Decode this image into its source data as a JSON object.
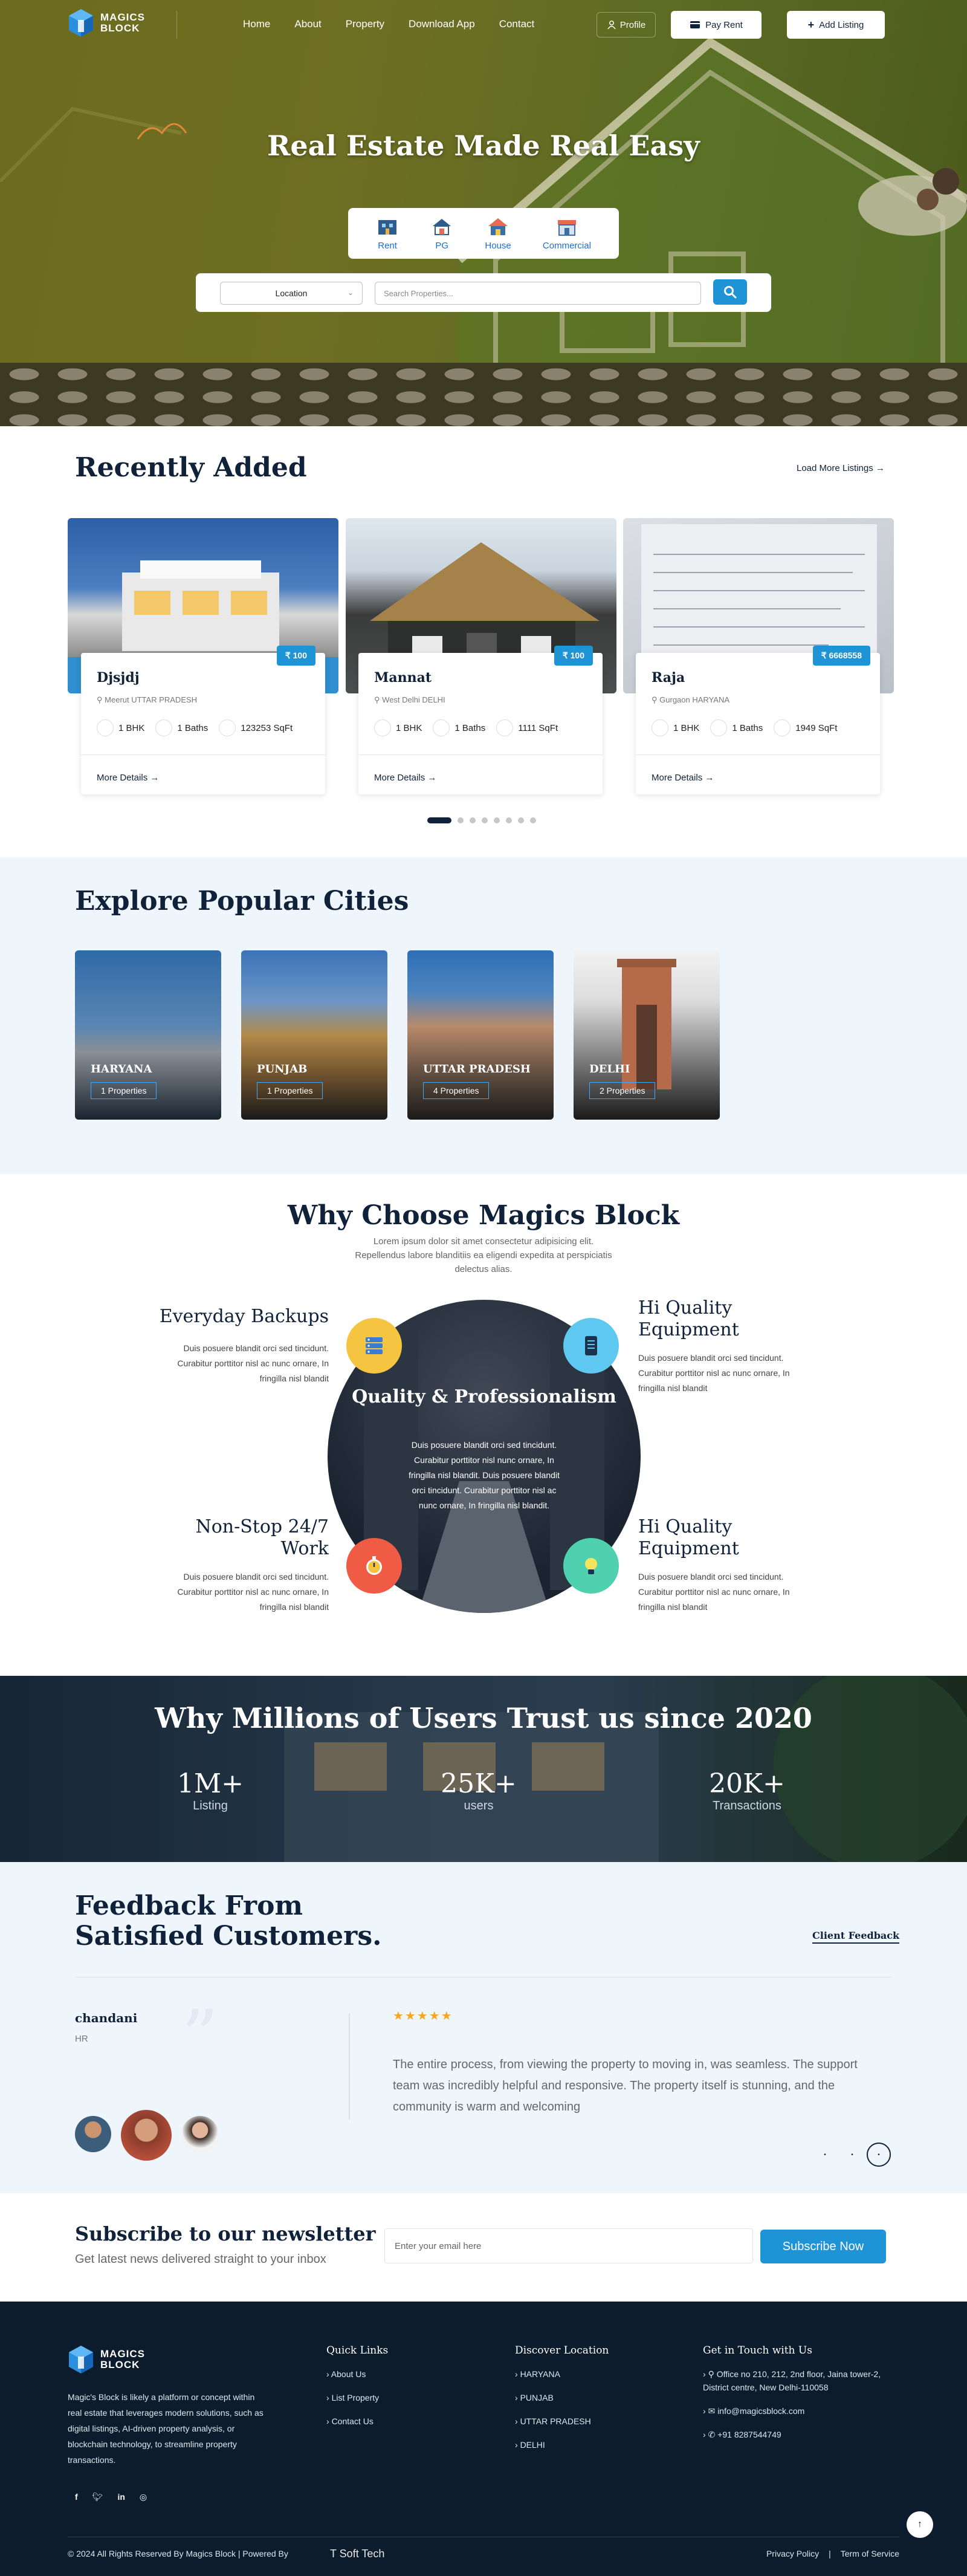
{
  "brand": {
    "line1": "MAGICS",
    "line2": "BLOCK",
    "accent": "#1e93d6",
    "dark": "#10223a"
  },
  "nav": {
    "links": [
      "Home",
      "About",
      "Property",
      "Download App",
      "Contact"
    ],
    "profile": "Profile",
    "pay_rent": "Pay Rent",
    "add_listing": "Add Listing"
  },
  "hero": {
    "title": "Real Estate Made Real Easy",
    "types": [
      "Rent",
      "PG",
      "House",
      "Commercial"
    ],
    "location_select": "Location",
    "search_placeholder": "Search Properties..."
  },
  "recent": {
    "title": "Recently Added",
    "load_more": "Load More Listings",
    "cards": [
      {
        "title": "Djsjdj",
        "price": "₹ 100",
        "location": "Meerut UTTAR PRADESH",
        "bhk": "1 BHK",
        "baths": "1 Baths",
        "area": "123253 SqFt",
        "more": "More Details"
      },
      {
        "title": "Mannat",
        "price": "₹ 100",
        "location": "West Delhi DELHI",
        "bhk": "1 BHK",
        "baths": "1 Baths",
        "area": "1111 SqFt",
        "more": "More Details"
      },
      {
        "title": "Raja",
        "price": "₹ 6668558",
        "location": "Gurgaon HARYANA",
        "bhk": "1 BHK",
        "baths": "1 Baths",
        "area": "1949 SqFt",
        "more": "More Details"
      }
    ]
  },
  "cities": {
    "title": "Explore Popular Cities",
    "items": [
      {
        "name": "HARYANA",
        "count": "1 Properties"
      },
      {
        "name": "PUNJAB",
        "count": "1 Properties"
      },
      {
        "name": "UTTAR PRADESH",
        "count": "4 Properties"
      },
      {
        "name": "DELHI",
        "count": "2 Properties"
      }
    ]
  },
  "why": {
    "title": "Why Choose Magics Block",
    "subtitle": "Lorem ipsum dolor sit amet consectetur adipisicing elit. Repellendus labore blanditiis ea eligendi expedita at perspiciatis delectus alias.",
    "center_title": "Quality & Professionalism",
    "center_desc": "Duis posuere blandit orci sed tincidunt. Curabitur porttitor nisl nunc ornare, In fringilla nisl blandit. Duis posuere blandit orci tincidunt. Curabitur porttitor nisl ac nunc ornare, In fringilla nisl blandit.",
    "features": [
      {
        "title": "Everyday Backups",
        "desc": "Duis posuere blandit orci sed tincidunt. Curabitur porttitor nisl ac nunc ornare, In fringilla nisl blandit"
      },
      {
        "title": "Hi Quality Equipment",
        "desc": "Duis posuere blandit orci sed tincidunt. Curabitur porttitor nisl ac nunc ornare, In fringilla nisl blandit"
      },
      {
        "title": "Non-Stop 24/7 Work",
        "desc": "Duis posuere blandit orci sed tincidunt. Curabitur porttitor nisl ac nunc ornare, In fringilla nisl blandit"
      },
      {
        "title": "Hi Quality Equipment",
        "desc": "Duis posuere blandit orci sed tincidunt. Curabitur porttitor nisl ac nunc ornare, In fringilla nisl blandit"
      }
    ]
  },
  "trust": {
    "title": "Why Millions of Users Trust us since 2020",
    "stats": [
      {
        "value": "1M+",
        "label": "Listing"
      },
      {
        "value": "25K+",
        "label": "users"
      },
      {
        "value": "20K+",
        "label": "Transactions"
      }
    ]
  },
  "feedback": {
    "title_line1": "Feedback From",
    "title_line2": "Satisfied Customers.",
    "link": "Client Feedback",
    "name": "chandani",
    "role": "HR",
    "rating": "★★★★★",
    "text": "The entire process, from viewing the property to moving in, was seamless. The support team was incredibly helpful and responsive. The property itself is stunning, and the community is warm and welcoming"
  },
  "newsletter": {
    "title": "Subscribe to our newsletter",
    "subtitle": "Get latest news delivered straight to your inbox",
    "placeholder": "Enter your email here",
    "button": "Subscribe Now"
  },
  "footer": {
    "desc": "Magic's Block is likely a platform or concept within real estate that leverages modern solutions, such as digital listings, AI-driven property analysis, or blockchain technology, to streamline property transactions.",
    "quick_links_title": "Quick Links",
    "quick_links": [
      "About Us",
      "List Property",
      "Contact Us"
    ],
    "discover_title": "Discover Location",
    "discover": [
      "HARYANA",
      "PUNJAB",
      "UTTAR PRADESH",
      "DELHI"
    ],
    "contact_title": "Get in Touch with Us",
    "address": "Office no 210, 212, 2nd floor, Jaina tower-2, District centre, New Delhi-110058",
    "email": "info@magicsblock.com",
    "phone": "+91 8287544749",
    "copyright": "© 2024 All Rights Reserved By Magics Block | Powered By",
    "powered": "T Soft Tech",
    "privacy": "Privacy Policy",
    "separator": "|",
    "terms": "Term of Service"
  }
}
